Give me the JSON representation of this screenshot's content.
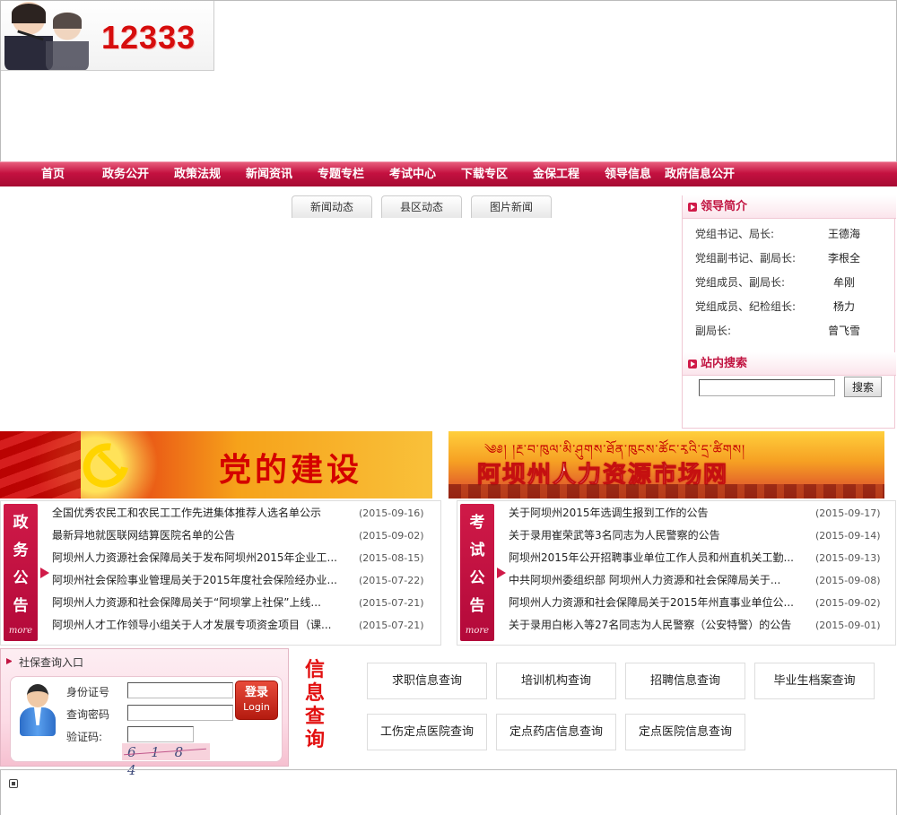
{
  "header": {
    "hotline": "12333"
  },
  "nav": [
    "首页",
    "政务公开",
    "政策法规",
    "新闻资讯",
    "专题专栏",
    "考试中心",
    "下载专区",
    "金保工程",
    "领导信息",
    "政府信息公开"
  ],
  "news_tabs": [
    "新闻动态",
    "县区动态",
    "图片新闻"
  ],
  "leaders": {
    "title": "领导简介",
    "items": [
      {
        "title": "党组书记、局长:",
        "name": "王德海"
      },
      {
        "title": "党组副书记、副局长:",
        "name": "李根全"
      },
      {
        "title": "党组成员、副局长:",
        "name": "牟刚"
      },
      {
        "title": "党组成员、纪检组长:",
        "name": "杨力"
      },
      {
        "title": "副局长:",
        "name": "曾飞雪"
      }
    ]
  },
  "search": {
    "title": "站内搜索",
    "button": "搜索"
  },
  "banners": {
    "left": "党的建设",
    "right_tibetan": "༄༅། །རྔ་བ་ཁུལ་མི་ཤུགས་ཐོན་ཁུངས་ཚོང་རྭའི་དྲ་ཚིགས།",
    "right": "阿坝州人力资源市场网"
  },
  "gov_notice": {
    "label_chars": [
      "政",
      "务",
      "公",
      "告"
    ],
    "more": "more",
    "items": [
      {
        "title": "全国优秀农民工和农民工工作先进集体推荐人选名单公示",
        "date": "(2015-09-16)"
      },
      {
        "title": "最新异地就医联网结算医院名单的公告",
        "date": "(2015-09-02)"
      },
      {
        "title": "阿坝州人力资源社会保障局关于发布阿坝州2015年企业工...",
        "date": "(2015-08-15)"
      },
      {
        "title": "阿坝州社会保险事业管理局关于2015年度社会保险经办业...",
        "date": "(2015-07-22)"
      },
      {
        "title": "阿坝州人力资源和社会保障局关于“阿坝掌上社保”上线...",
        "date": "(2015-07-21)"
      },
      {
        "title": "阿坝州人才工作领导小组关于人才发展专项资金项目（课...",
        "date": "(2015-07-21)"
      }
    ]
  },
  "exam_notice": {
    "label_chars": [
      "考",
      "试",
      "公",
      "告"
    ],
    "more": "more",
    "items": [
      {
        "title": "关于阿坝州2015年选调生报到工作的公告",
        "date": "(2015-09-17)"
      },
      {
        "title": "关于录用崔荣武等3名同志为人民警察的公告",
        "date": "(2015-09-14)"
      },
      {
        "title": "阿坝州2015年公开招聘事业单位工作人员和州直机关工勤...",
        "date": "(2015-09-13)"
      },
      {
        "title": "中共阿坝州委组织部 阿坝州人力资源和社会保障局关于...",
        "date": "(2015-09-08)"
      },
      {
        "title": "阿坝州人力资源和社会保障局关于2015年州直事业单位公...",
        "date": "(2015-09-02)"
      },
      {
        "title": "关于录用白彬入等27名同志为人民警察（公安特警）的公告",
        "date": "(2015-09-01)"
      }
    ]
  },
  "login": {
    "title": "社保查询入口",
    "id_label": "身份证号",
    "pwd_label": "查询密码",
    "captcha_label": "验证码:",
    "captcha": "6 1 8 4",
    "button_cn": "登录",
    "button_en": "Login"
  },
  "info_query": {
    "title_chars": [
      "信",
      "息",
      "查",
      "询"
    ],
    "buttons": [
      "求职信息查询",
      "培训机构查询",
      "招聘信息查询",
      "毕业生档案查询",
      "工伤定点医院查询",
      "定点药店信息查询",
      "定点医院信息查询"
    ]
  },
  "colors": {
    "brand_red": "#c41140",
    "accent_red": "#d01a48"
  }
}
